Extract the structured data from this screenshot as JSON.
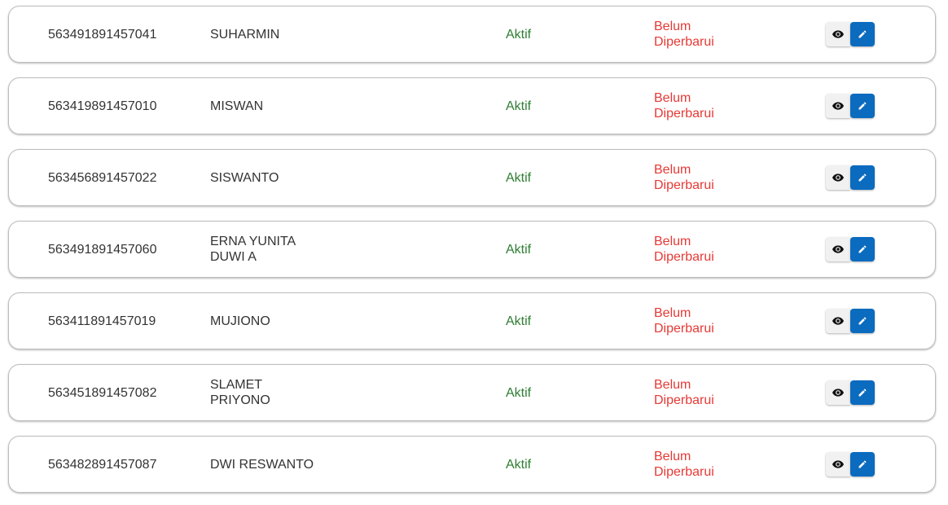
{
  "rows": [
    {
      "nik": "563491891457041",
      "nama": [
        "SUHARMIN"
      ],
      "status": "Aktif",
      "update": [
        "Belum",
        "Diperbarui"
      ]
    },
    {
      "nik": "563419891457010",
      "nama": [
        "MISWAN"
      ],
      "status": "Aktif",
      "update": [
        "Belum",
        "Diperbarui"
      ]
    },
    {
      "nik": "563456891457022",
      "nama": [
        "SISWANTO"
      ],
      "status": "Aktif",
      "update": [
        "Belum",
        "Diperbarui"
      ]
    },
    {
      "nik": "563491891457060",
      "nama": [
        "ERNA YUNITA",
        "DUWI A"
      ],
      "status": "Aktif",
      "update": [
        "Belum",
        "Diperbarui"
      ]
    },
    {
      "nik": "563411891457019",
      "nama": [
        "MUJIONO"
      ],
      "status": "Aktif",
      "update": [
        "Belum",
        "Diperbarui"
      ]
    },
    {
      "nik": "563451891457082",
      "nama": [
        "SLAMET",
        "PRIYONO"
      ],
      "status": "Aktif",
      "update": [
        "Belum",
        "Diperbarui"
      ]
    },
    {
      "nik": "563482891457087",
      "nama": [
        "DWI RESWANTO"
      ],
      "status": "Aktif",
      "update": [
        "Belum",
        "Diperbarui"
      ]
    }
  ],
  "icons": {
    "view": "eye-icon",
    "edit": "pencil-icon"
  },
  "colors": {
    "status_active": "#2e7d32",
    "update_pending": "#e53935",
    "edit_button": "#0a6bbf",
    "view_button": "#f1f1f1"
  }
}
